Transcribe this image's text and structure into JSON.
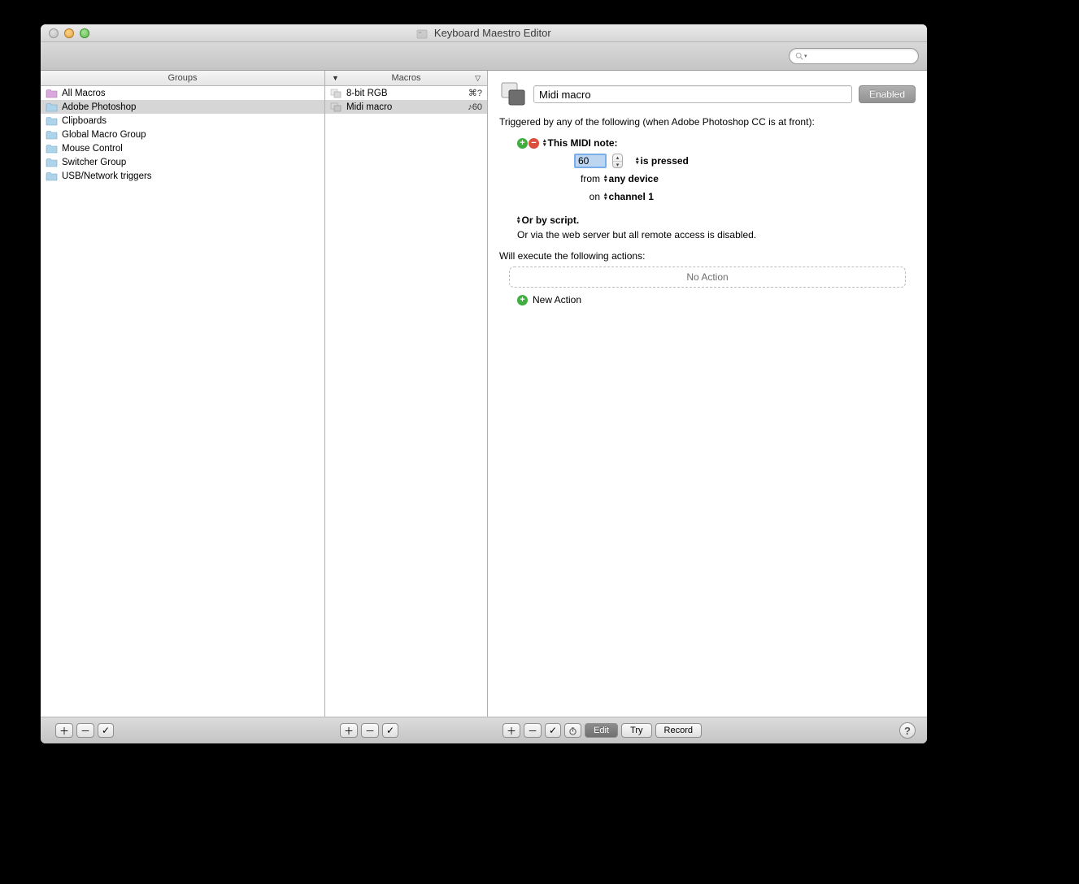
{
  "window": {
    "title": "Keyboard Maestro Editor"
  },
  "toolbar": {
    "search_placeholder": ""
  },
  "columns": {
    "groups_header": "Groups",
    "macros_header": "Macros"
  },
  "groups": [
    {
      "name": "All Macros",
      "special": true
    },
    {
      "name": "Adobe Photoshop",
      "selected": true
    },
    {
      "name": "Clipboards"
    },
    {
      "name": "Global Macro Group"
    },
    {
      "name": "Mouse Control"
    },
    {
      "name": "Switcher Group"
    },
    {
      "name": "USB/Network triggers"
    }
  ],
  "macros": [
    {
      "name": "8-bit RGB",
      "shortcut": "⌘?"
    },
    {
      "name": "Midi macro",
      "shortcut": "♪60",
      "selected": true
    }
  ],
  "detail": {
    "macro_name": "Midi macro",
    "enabled_label": "Enabled",
    "triggered_text": "Triggered by any of the following (when Adobe Photoshop CC is at front):",
    "trigger_type": "This MIDI note:",
    "midi_value": "60",
    "midi_action": "is pressed",
    "from_label": "from",
    "from_value": "any device",
    "on_label": "on",
    "on_value": "channel 1",
    "or_script": "Or by script.",
    "web_server": "Or via the web server but all remote access is disabled.",
    "exec_label": "Will execute the following actions:",
    "no_action": "No Action",
    "new_action": "New Action"
  },
  "footer": {
    "edit": "Edit",
    "try": "Try",
    "record": "Record"
  }
}
